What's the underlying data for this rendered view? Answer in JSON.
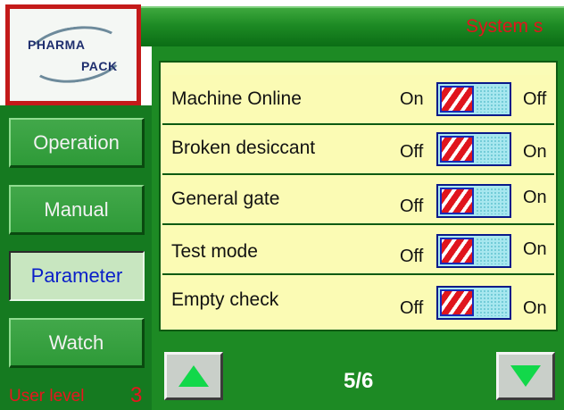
{
  "logo": {
    "line1": "PHARMA",
    "line2": "PACK"
  },
  "title": "System s",
  "sidebar": {
    "items": [
      {
        "label": "Operation"
      },
      {
        "label": "Manual"
      },
      {
        "label": "Parameter",
        "active": true
      },
      {
        "label": "Watch"
      }
    ],
    "user_level_label": "User level",
    "user_level_value": "3"
  },
  "parameters": [
    {
      "label": "Machine Online",
      "left_state": "On",
      "right_state": "Off"
    },
    {
      "label": "Broken desiccant",
      "left_state": "Off",
      "right_state": "On"
    },
    {
      "label": " General gate",
      "left_state": "Off",
      "right_state": "On"
    },
    {
      "label": "Test mode",
      "left_state": "Off",
      "right_state": "On"
    },
    {
      "label": "Empty check",
      "left_state": "Off",
      "right_state": "On"
    }
  ],
  "pagination": {
    "indicator": "5/6",
    "up_icon": "triangle-up-icon",
    "down_icon": "triangle-down-icon"
  },
  "colors": {
    "panel_green": "#1d8a24",
    "row_yellow": "#fbfbb4",
    "alert_red": "#e0151d",
    "active_text_blue": "#0a1fc8"
  }
}
